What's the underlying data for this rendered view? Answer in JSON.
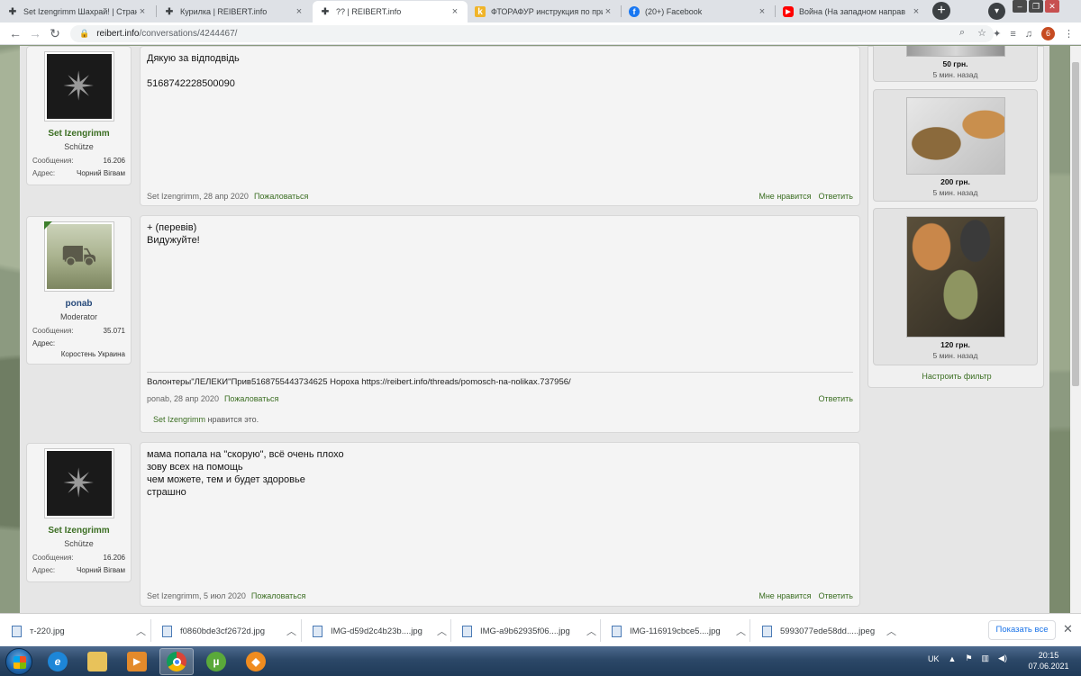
{
  "browser": {
    "tabs": [
      {
        "title": "Set Izengrimm Шахрай! | Страни",
        "icon": "cross-favicon"
      },
      {
        "title": "Курилка | REIBERT.info",
        "icon": "cross-favicon"
      },
      {
        "title": "?? | REIBERT.info",
        "icon": "cross-favicon",
        "active": true
      },
      {
        "title": "ФТОРАФУР инструкция по прим",
        "icon": "k-favicon"
      },
      {
        "title": "(20+) Facebook",
        "icon": "facebook-favicon"
      },
      {
        "title": "Война (На западном направ",
        "icon": "youtube-favicon"
      }
    ],
    "new_tab": "+",
    "url_host": "reibert.info",
    "url_path": "/conversations/4244467/",
    "profile_badge": "6"
  },
  "messages": [
    {
      "author": "Set Izengrimm",
      "user_title": "Schütze",
      "posts_label": "Сообщения:",
      "posts": "16.206",
      "address_label": "Адрес:",
      "address": "Чорний Вігвам",
      "body": [
        "Дякую за відподвідь",
        "",
        "5168742228500090"
      ],
      "meta_author": "Set Izengrimm, 28 апр 2020",
      "report": "Пожаловаться",
      "like": "Мне нравится",
      "reply": "Ответить"
    },
    {
      "author": "ponab",
      "user_title": "Moderator",
      "posts_label": "Сообщения:",
      "posts": "35.071",
      "address_label": "Адрес:",
      "address": "Коростень Украина",
      "body": [
        "+ (перевів)",
        "Видужуйте!"
      ],
      "signature": "Волонтеры\"ЛЕЛЕКИ\"Прив5168755443734625 Нороха https://reibert.info/threads/pomosch-na-nolikax.737956/",
      "meta_author": "ponab, 28 апр 2020",
      "report": "Пожаловаться",
      "reply": "Ответить",
      "liked_by": "Set Izengrimm",
      "liked_suffix": " нравится это."
    },
    {
      "author": "Set Izengrimm",
      "user_title": "Schütze",
      "posts_label": "Сообщения:",
      "posts": "16.206",
      "address_label": "Адрес:",
      "address": "Чорний Вігвам",
      "body": [
        "мама попала на \"скорую\", всё очень плохо",
        "зову всех на помощь",
        "чем можете, тем и будет здоровье",
        "страшно"
      ],
      "meta_author": "Set Izengrimm, 5 июл 2020",
      "report": "Пожаловаться",
      "like": "Мне нравится",
      "reply": "Ответить"
    }
  ],
  "sidebar": {
    "cards": [
      {
        "price": "50 грн.",
        "ago": "5 мин. назад"
      },
      {
        "price": "200 грн.",
        "ago": "5 мин. назад"
      },
      {
        "price": "120 грн.",
        "ago": "5 мин. назад"
      }
    ],
    "filter_link": "Настроить фильтр"
  },
  "downloads": {
    "items": [
      "т-220.jpg",
      "f0860bde3cf2672d.jpg",
      "IMG-d59d2c4b23b....jpg",
      "IMG-a9b62935f06....jpg",
      "IMG-116919cbce5....jpg",
      "5993077ede58dd.....jpeg"
    ],
    "show_all": "Показать все",
    "close": "✕"
  },
  "taskbar": {
    "lang": "UK",
    "time": "20:15",
    "date": "07.06.2021"
  },
  "colors": {
    "link_green": "#3b6e22",
    "mod_blue": "#274a7a",
    "camo_bg": "#8c9a80"
  }
}
